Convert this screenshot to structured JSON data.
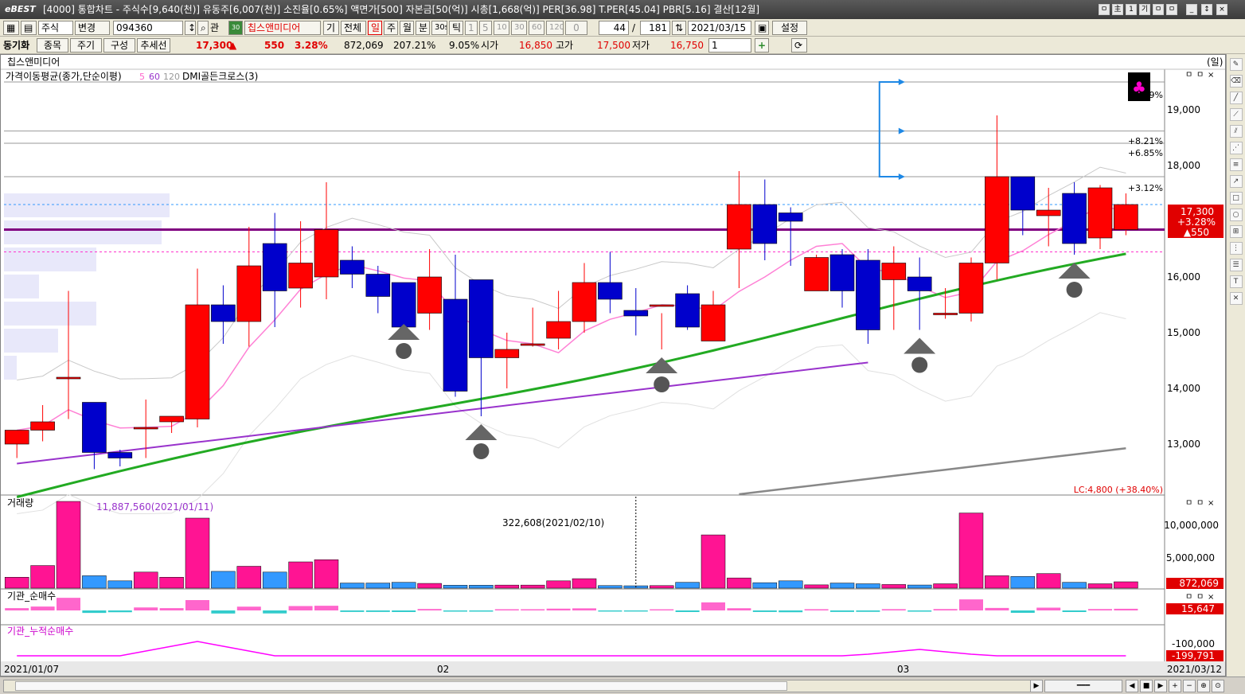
{
  "window": {
    "logo": "eBEST",
    "title": "[4000] 통합차트 - 주식수[9,640(천)] 유동주[6,007(천)] 소진율[0.65%] 액면가[500] 자본금[50(억)] 시총[1,668(억)] PER[36.98] T.PER[45.04] PBR[5.16] 결산[12월]",
    "right_buttons": [
      "ㅁ",
      "主",
      "1",
      "기",
      "ㅁ",
      "ㅁ"
    ],
    "controls": [
      "_",
      "↕",
      "×"
    ]
  },
  "toolbar1": {
    "asset_type": "주식",
    "change": "변경",
    "code": "094360",
    "gwan": "관",
    "name": "칩스앤미디어",
    "gi": "기",
    "all": "전체",
    "periods": [
      "일",
      "주",
      "월",
      "분",
      "30s",
      "틱"
    ],
    "interval_buttons": [
      "1",
      "5",
      "10",
      "30",
      "60",
      "120"
    ],
    "interval_value": "0",
    "count": "44",
    "slash": "/",
    "total": "181",
    "date": "2021/03/15",
    "settings": "설정"
  },
  "toolbar2": {
    "sync": "동기화",
    "btn_item": "종목",
    "btn_period": "주기",
    "btn_compose": "구성",
    "btn_trend": "추세선",
    "price": "17,300",
    "up_arrow": "▲",
    "change": "550",
    "change_pct": "3.28%",
    "volume": "872,069",
    "vol_ratio": "207.21%",
    "range_pct": "9.05%",
    "open_label": "시가",
    "open": "16,850",
    "high_label": "고가",
    "high": "17,500",
    "low_label": "저가",
    "low": "16,750",
    "multi": "1"
  },
  "chart": {
    "stock_name": "칩스앤미디어",
    "period_tag": "(일)",
    "legend_ma": "가격이동평균(종가,단순이평)",
    "ma_periods": [
      "5",
      "60",
      "120"
    ],
    "legend_dmi": "DMI골든크로스(3)",
    "pct_labels": [
      "29%",
      "+8.21%",
      "+6.85%",
      "+3.12%"
    ],
    "price_ticks": [
      "19,000",
      "18,000",
      "17,000",
      "16,000",
      "15,000",
      "14,000",
      "13,000"
    ],
    "current_price": "17,300",
    "current_pct": "+3.28%",
    "current_change": "▲550",
    "lc_label": "LC:4,800 (+38.40%)",
    "volume_title": "거래량",
    "volume_max_label": "11,887,560(2021/01/11)",
    "volume_cursor_label": "322,608(2021/02/10)",
    "volume_ticks": [
      "10,000,000",
      "5,000,000"
    ],
    "volume_current": "872,069",
    "inst_title": "기관_순매수",
    "inst_current": "15,647",
    "cum_title": "기관_누적순매수",
    "cum_tick": "-100,000",
    "cum_current": "-199,791",
    "panel_buttons": [
      "ㅁ",
      "ㅁ",
      "×"
    ],
    "date_labels": [
      "2021/01/07",
      "02",
      "03",
      "2021/03/12"
    ]
  },
  "chart_data": {
    "type": "candlestick",
    "x": [
      "2021/01/07",
      "2021/01/08",
      "2021/01/11",
      "2021/01/12",
      "2021/01/13",
      "2021/01/14",
      "2021/01/15",
      "2021/01/18",
      "2021/01/19",
      "2021/01/20",
      "2021/01/21",
      "2021/01/22",
      "2021/01/25",
      "2021/01/26",
      "2021/01/27",
      "2021/01/28",
      "2021/01/29",
      "2021/02/01",
      "2021/02/02",
      "2021/02/03",
      "2021/02/04",
      "2021/02/05",
      "2021/02/08",
      "2021/02/09",
      "2021/02/10",
      "2021/02/15",
      "2021/02/16",
      "2021/02/17",
      "2021/02/18",
      "2021/02/19",
      "2021/02/22",
      "2021/02/23",
      "2021/02/24",
      "2021/02/25",
      "2021/02/26",
      "2021/03/02",
      "2021/03/03",
      "2021/03/04",
      "2021/03/05",
      "2021/03/08",
      "2021/03/09",
      "2021/03/10",
      "2021/03/11",
      "2021/03/12"
    ],
    "open": [
      13000,
      13250,
      14200,
      13750,
      12850,
      13300,
      13400,
      13450,
      15500,
      15200,
      16600,
      15800,
      16000,
      16300,
      16050,
      15900,
      15350,
      15600,
      15950,
      14550,
      14800,
      14900,
      15200,
      15900,
      15400,
      15500,
      15700,
      14850,
      16500,
      17300,
      17150,
      15750,
      16400,
      16300,
      15950,
      16000,
      15350,
      15350,
      16250,
      17800,
      17100,
      17500,
      16700,
      16850
    ],
    "close": [
      13250,
      13400,
      14200,
      12850,
      12750,
      13300,
      13500,
      15500,
      15200,
      16200,
      15750,
      16250,
      16850,
      16050,
      15650,
      15100,
      16000,
      13950,
      14550,
      14700,
      14800,
      15200,
      15900,
      15600,
      15300,
      15500,
      15100,
      15500,
      17300,
      16600,
      17000,
      16350,
      15750,
      15050,
      16250,
      15750,
      15350,
      16250,
      17800,
      17200,
      17200,
      16600,
      17600,
      17300
    ],
    "high": [
      13050,
      13700,
      15750,
      13700,
      12900,
      13800,
      13500,
      16150,
      15850,
      16900,
      17150,
      17000,
      17700,
      16550,
      16200,
      15900,
      16500,
      16400,
      14800,
      15000,
      15450,
      15750,
      16250,
      16450,
      15800,
      15350,
      15850,
      15750,
      17900,
      17750,
      17250,
      16400,
      16500,
      16500,
      16550,
      16350,
      15800,
      16350,
      18900,
      17800,
      17600,
      17700,
      17650,
      17500
    ],
    "low": [
      12750,
      13050,
      13450,
      12550,
      12600,
      12750,
      13200,
      13300,
      14800,
      14750,
      15100,
      15450,
      15600,
      15800,
      15350,
      15300,
      15050,
      13850,
      13500,
      14000,
      14750,
      14700,
      15000,
      15350,
      14950,
      14700,
      15050,
      14850,
      15800,
      16300,
      16200,
      16050,
      15450,
      14800,
      15050,
      15050,
      15250,
      15200,
      15950,
      16750,
      16550,
      16400,
      16500,
      16750
    ],
    "volume": [
      1500000,
      3100000,
      11887560,
      1700000,
      1000000,
      2200000,
      1500000,
      9600000,
      2300000,
      3000000,
      2200000,
      3600000,
      3900000,
      700000,
      700000,
      800000,
      650000,
      400000,
      400000,
      420000,
      420000,
      1000000,
      1300000,
      350000,
      322608,
      350000,
      800000,
      7300000,
      1400000,
      750000,
      1000000,
      450000,
      700000,
      600000,
      500000,
      430000,
      600000,
      10300000,
      1700000,
      1600000,
      2000000,
      800000,
      600000,
      872069
    ],
    "ylim": [
      12100,
      19700
    ]
  }
}
